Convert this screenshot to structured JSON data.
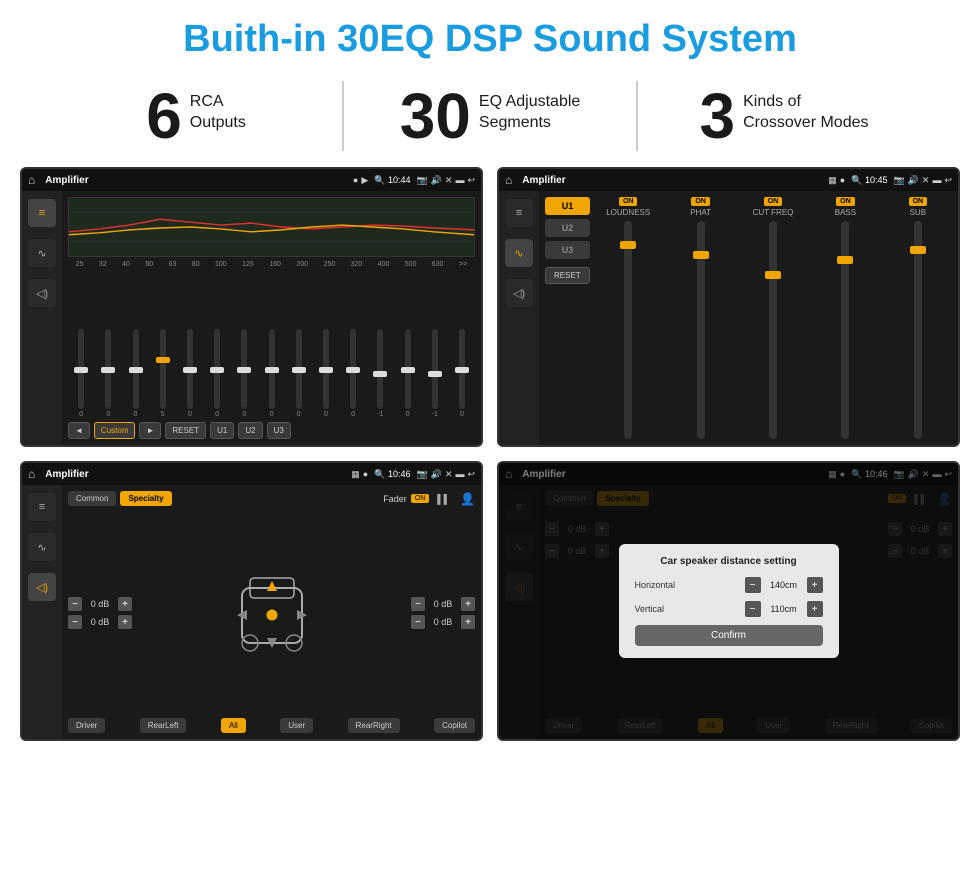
{
  "page": {
    "title": "Buith-in 30EQ DSP Sound System"
  },
  "stats": [
    {
      "number": "6",
      "label": "RCA\nOutputs"
    },
    {
      "number": "30",
      "label": "EQ Adjustable\nSegments"
    },
    {
      "number": "3",
      "label": "Kinds of\nCrossover Modes"
    }
  ],
  "screens": [
    {
      "id": "eq-screen",
      "status": {
        "title": "Amplifier",
        "time": "10:44"
      },
      "type": "eq"
    },
    {
      "id": "crossover-screen",
      "status": {
        "title": "Amplifier",
        "time": "10:45"
      },
      "type": "crossover"
    },
    {
      "id": "fader-screen",
      "status": {
        "title": "Amplifier",
        "time": "10:46"
      },
      "type": "fader"
    },
    {
      "id": "dialog-screen",
      "status": {
        "title": "Amplifier",
        "time": "10:46"
      },
      "type": "dialog"
    }
  ],
  "eq": {
    "freqs": [
      "25",
      "32",
      "40",
      "50",
      "63",
      "80",
      "100",
      "125",
      "160",
      "200",
      "250",
      "320",
      "400",
      "500",
      "630"
    ],
    "values": [
      "0",
      "0",
      "0",
      "5",
      "0",
      "0",
      "0",
      "0",
      "0",
      "0",
      "0",
      "-1",
      "0",
      "-1",
      "0"
    ],
    "mode": "Custom",
    "buttons": [
      "RESET",
      "U1",
      "U2",
      "U3"
    ]
  },
  "crossover": {
    "channels": [
      "U1",
      "U2",
      "U3"
    ],
    "cols": [
      {
        "label": "LOUDNESS",
        "on": true
      },
      {
        "label": "PHAT",
        "on": true
      },
      {
        "label": "CUT FREQ",
        "on": true
      },
      {
        "label": "BASS",
        "on": true
      },
      {
        "label": "SUB",
        "on": true
      }
    ],
    "reset_label": "RESET"
  },
  "fader": {
    "tabs": [
      "Common",
      "Specialty"
    ],
    "fader_label": "Fader",
    "on_label": "ON",
    "db_values": [
      "0 dB",
      "0 dB",
      "0 dB",
      "0 dB"
    ],
    "bottom_buttons": [
      "Driver",
      "RearLeft",
      "All",
      "User",
      "RearRight",
      "Copilot"
    ]
  },
  "dialog": {
    "title": "Car speaker distance setting",
    "rows": [
      {
        "label": "Horizontal",
        "value": "140cm"
      },
      {
        "label": "Vertical",
        "value": "110cm"
      }
    ],
    "confirm_label": "Confirm",
    "fader": {
      "tabs": [
        "Common",
        "Specialty"
      ],
      "db_values": [
        "0 dB",
        "0 dB"
      ],
      "bottom_buttons": [
        "Driver",
        "RearLeft",
        "All",
        "User",
        "RearRight",
        "Copilot"
      ]
    }
  }
}
